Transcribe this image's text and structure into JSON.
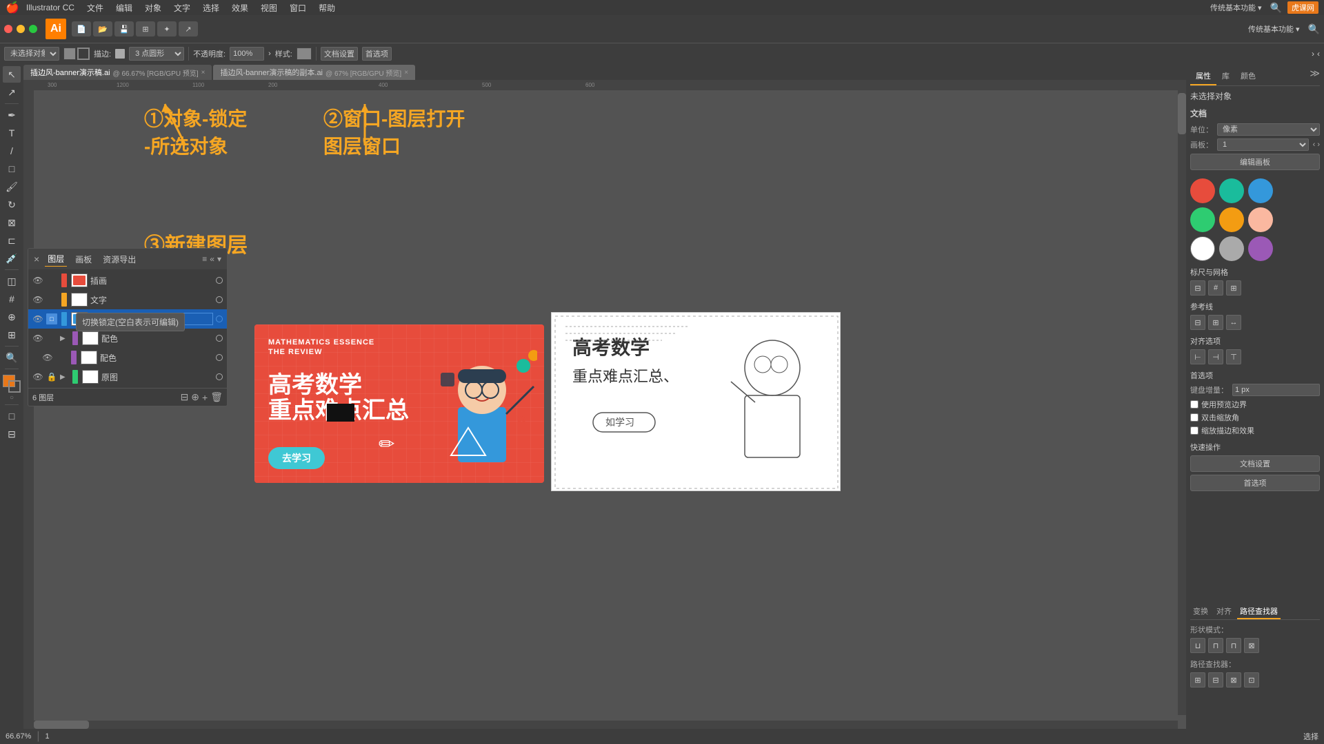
{
  "app": {
    "title": "Adobe Illustrator CC",
    "logo": "Ai",
    "version": "CC"
  },
  "menubar": {
    "apple": "🍎",
    "items": [
      "Illustrator CC",
      "文件",
      "编辑",
      "对象",
      "文字",
      "选择",
      "效果",
      "视图",
      "窗口",
      "帮助"
    ]
  },
  "toolbar2": {
    "label1": "未选择对象",
    "label2": "描边:",
    "label3": "3 点圆形",
    "label4": "不透明度:",
    "label5": "100%",
    "label6": "样式:",
    "btn1": "文档设置",
    "btn2": "首选项"
  },
  "tabs": [
    {
      "name": "插边风-banner演示稿.ai",
      "extra": "@ 66.67% [RGB/GPU 预览]",
      "active": true
    },
    {
      "name": "插边风-banner演示稿的副本.ai",
      "extra": "@ 67% [RGB/GPU 预览]",
      "active": false
    }
  ],
  "annotations": {
    "step1": "①对象-锁定",
    "step1b": "-所选对象",
    "step2": "②窗口-图层打开",
    "step2b": "图层窗口",
    "step3": "③新建图层"
  },
  "rightPanel": {
    "tabs": [
      "属性",
      "库",
      "颜色"
    ],
    "activeTab": "属性",
    "section1": "未选择对象",
    "document": "文档",
    "unit_label": "单位：",
    "unit": "像素",
    "template_label": "画板：",
    "template_val": "1",
    "btn_edit_template": "编辑画板",
    "section2": "标尺与网格",
    "section3": "参考线",
    "section4": "对齐选项",
    "section5": "首选项",
    "kbd_label": "键盘增量：",
    "kbd_val": "1 px",
    "chk1": "使用预览边界",
    "chk2": "双击缩放角",
    "chk3": "缩放描边和效果",
    "quick_label": "快速操作",
    "btn_doc_settings": "文档设置",
    "btn_prefs": "首选项",
    "colors": [
      {
        "color": "#e74c3c",
        "label": "red"
      },
      {
        "color": "#1abc9c",
        "label": "teal"
      },
      {
        "color": "#3498db",
        "label": "blue"
      },
      {
        "color": "#2ecc71",
        "label": "cyan"
      },
      {
        "color": "#f39c12",
        "label": "orange"
      },
      {
        "color": "#fab8a0",
        "label": "salmon"
      },
      {
        "color": "#ffffff",
        "label": "white"
      },
      {
        "color": "#aaaaaa",
        "label": "gray"
      },
      {
        "color": "#9b59b6",
        "label": "purple"
      }
    ],
    "bottomTabs": [
      "变换",
      "对齐",
      "路径查找器"
    ],
    "pathLabel": "形状模式：",
    "pathLabel2": "路径查找器："
  },
  "layersPanel": {
    "tabs": [
      "图层",
      "画板",
      "资源导出"
    ],
    "activeTab": "图层",
    "layers": [
      {
        "name": "插画",
        "color": "#e74c3c",
        "visible": true,
        "locked": false,
        "hasThumb": true
      },
      {
        "name": "文字",
        "color": "#f5a623",
        "visible": true,
        "locked": false,
        "hasThumb": false
      },
      {
        "name": "",
        "color": "#3498db",
        "visible": true,
        "locked": false,
        "hasThumb": true,
        "editing": true
      },
      {
        "name": "配色",
        "color": "#9b59b6",
        "visible": true,
        "locked": false,
        "hasThumb": false,
        "expanded": true,
        "subItems": [
          "配色"
        ]
      },
      {
        "name": "原图",
        "color": "#2ecc71",
        "visible": true,
        "locked": true,
        "hasThumb": false,
        "expanded": true
      }
    ],
    "footer": "6 图层"
  },
  "tooltip": {
    "text": "切换锁定(空白表示可编辑)"
  },
  "banner": {
    "subtitle": "MATHEMATICS ESSENCE",
    "subtitle2": "THE REVIEW",
    "title": "高考数学",
    "title2": "重点难点汇总",
    "btn": "去学习"
  },
  "bottomBar": {
    "zoom": "66.67%",
    "artboard": "1",
    "tool": "选择"
  },
  "siteWatermark": "虎课网"
}
